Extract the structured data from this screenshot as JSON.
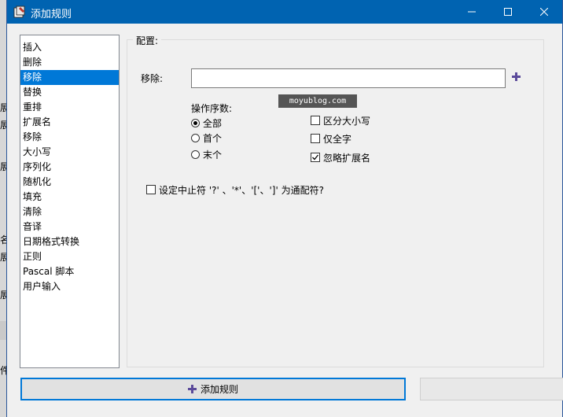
{
  "background": {
    "fragments": [
      "展",
      "展",
      "展",
      "名",
      "展",
      "展",
      "件"
    ]
  },
  "window": {
    "title": "添加规则",
    "accent": "#0063b1"
  },
  "rules": {
    "items": [
      "插入",
      "删除",
      "移除",
      "替换",
      "重排",
      "扩展名",
      "移除",
      "大小写",
      "序列化",
      "随机化",
      "填充",
      "清除",
      "音译",
      "日期格式转换",
      "正则",
      "Pascal 脚本",
      "用户输入"
    ],
    "selected_index": 2,
    "selection_color": "#0078d7"
  },
  "config": {
    "legend": "配置:",
    "remove_label": "移除:",
    "remove_value": "",
    "ops_label": "操作序数:",
    "radios": [
      {
        "label": "全部",
        "checked": true
      },
      {
        "label": "首个",
        "checked": false
      },
      {
        "label": "末个",
        "checked": false
      }
    ],
    "checks": [
      {
        "label": "区分大小写",
        "checked": false
      },
      {
        "label": "仅全字",
        "checked": false
      },
      {
        "label": "忽略扩展名",
        "checked": true
      }
    ],
    "wildcard_label": "设定中止符 '?' 、'*'、'['、']' 为通配符?",
    "wildcard_checked": false,
    "plus_icon": "plus-icon",
    "plus_color": "#5b4a9a"
  },
  "watermark": "moyublog.com",
  "buttons": {
    "add_rule": "添加规则"
  }
}
